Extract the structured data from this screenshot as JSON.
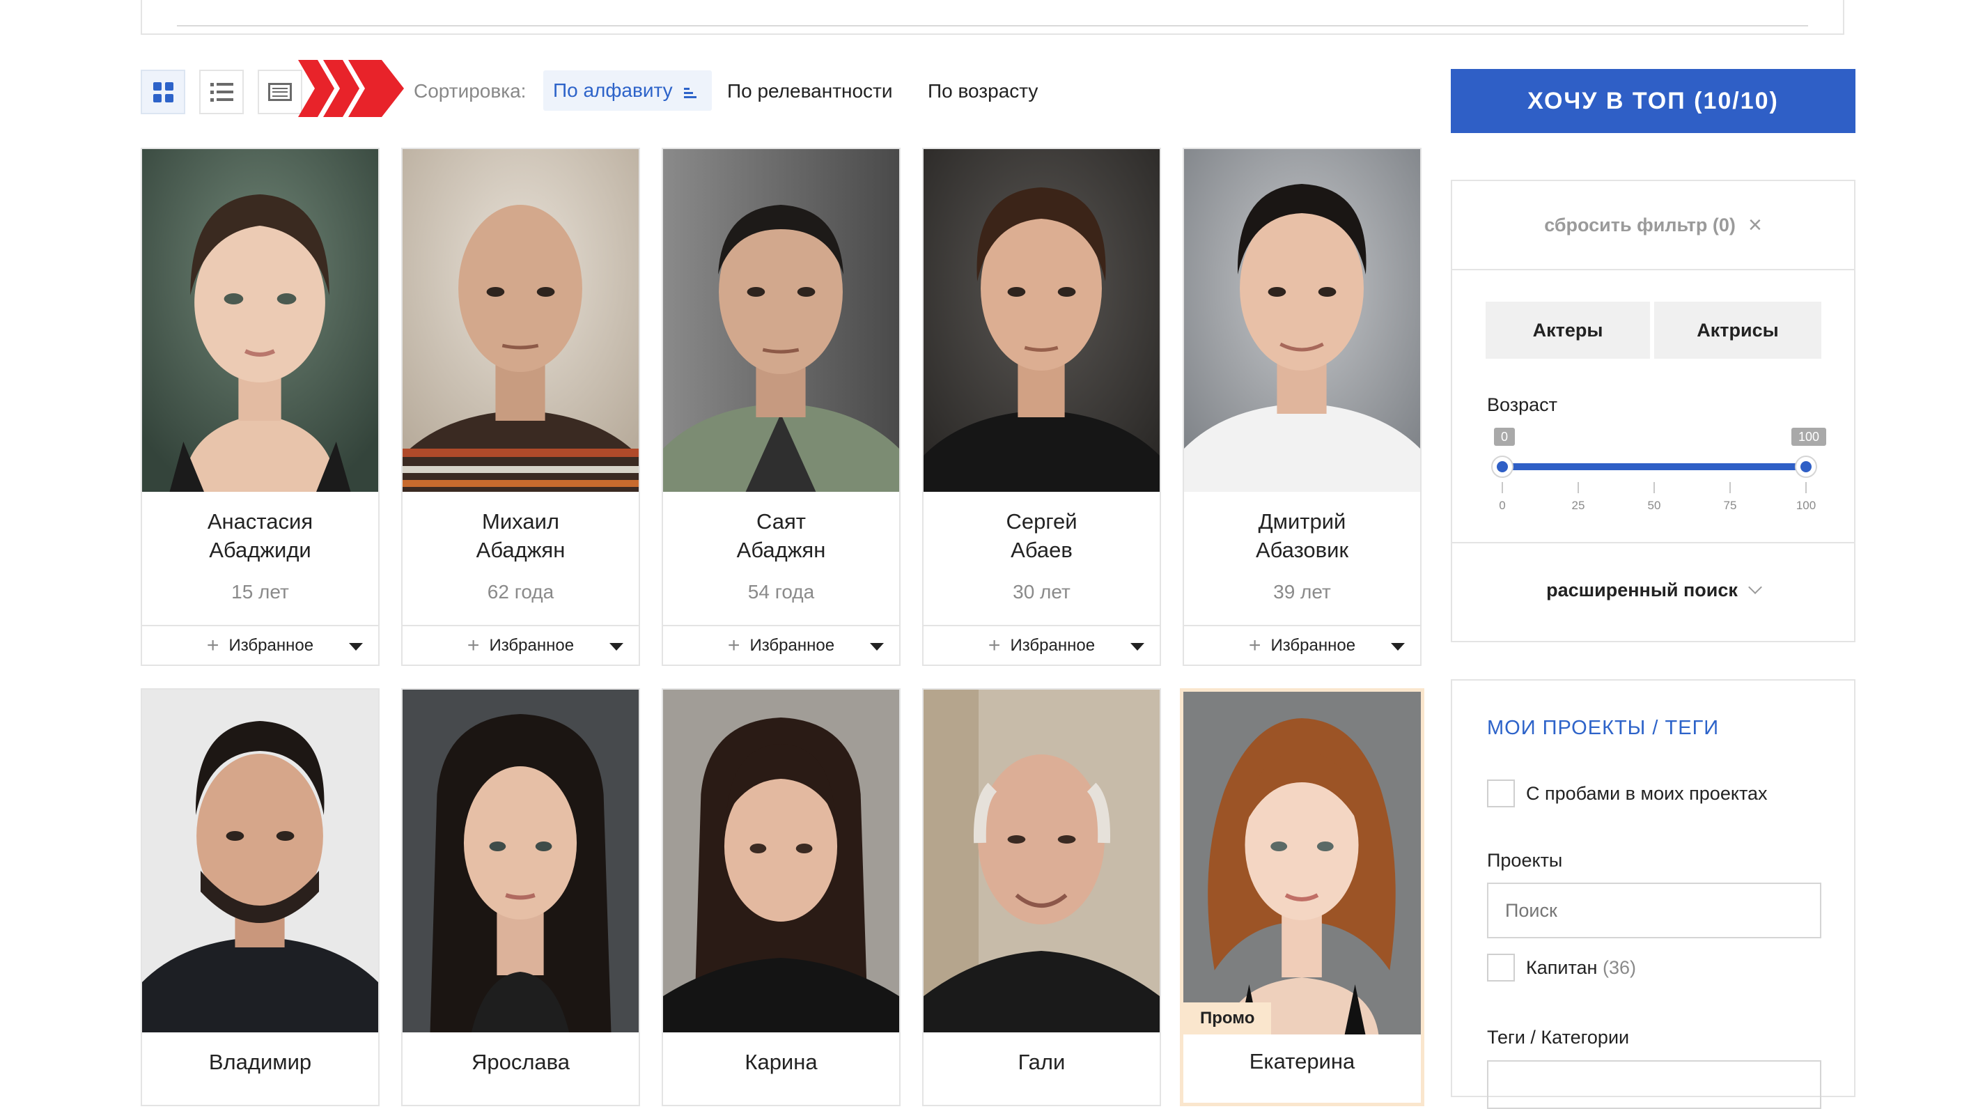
{
  "toolbar": {
    "sort_label": "Сортировка:",
    "sort_options": [
      "По алфавиту",
      "По релевантности",
      "По возрасту"
    ],
    "active_sort": "По алфавиту",
    "view_modes": [
      "grid-view",
      "list-view",
      "table-view"
    ],
    "top_button": "ХОЧУ В ТОП (10/10)"
  },
  "cards": [
    {
      "first": "Анастасия",
      "last": "Абаджиди",
      "age": "15 лет",
      "fav": "Избранное"
    },
    {
      "first": "Михаил",
      "last": "Абаджян",
      "age": "62 года",
      "fav": "Избранное"
    },
    {
      "first": "Саят",
      "last": "Абаджян",
      "age": "54 года",
      "fav": "Избранное"
    },
    {
      "first": "Сергей",
      "last": "Абаев",
      "age": "30 лет",
      "fav": "Избранное"
    },
    {
      "first": "Дмитрий",
      "last": "Абазовик",
      "age": "39 лет",
      "fav": "Избранное"
    },
    {
      "first": "Владимир"
    },
    {
      "first": "Ярослава"
    },
    {
      "first": "Карина"
    },
    {
      "first": "Гали"
    },
    {
      "first": "Екатерина",
      "promo": "Промо"
    }
  ],
  "filter": {
    "reset": "сбросить фильтр (0)",
    "gender_actors": "Актеры",
    "gender_actresses": "Актрисы",
    "age_label": "Возраст",
    "age_min": "0",
    "age_max": "100",
    "ticks": [
      "0",
      "25",
      "50",
      "75",
      "100"
    ],
    "advanced": "расширенный поиск"
  },
  "projects": {
    "title": "МОИ ПРОЕКТЫ / ТЕГИ",
    "with_tests": "С пробами в моих проектах",
    "projects_label": "Проекты",
    "search_placeholder": "Поиск",
    "project_name": "Капитан",
    "project_count": "(36)",
    "tags_label": "Теги / Категории"
  },
  "colors": {
    "accent": "#2f5fc6",
    "arrow": "#e8232a",
    "promo": "#fae6cd"
  }
}
